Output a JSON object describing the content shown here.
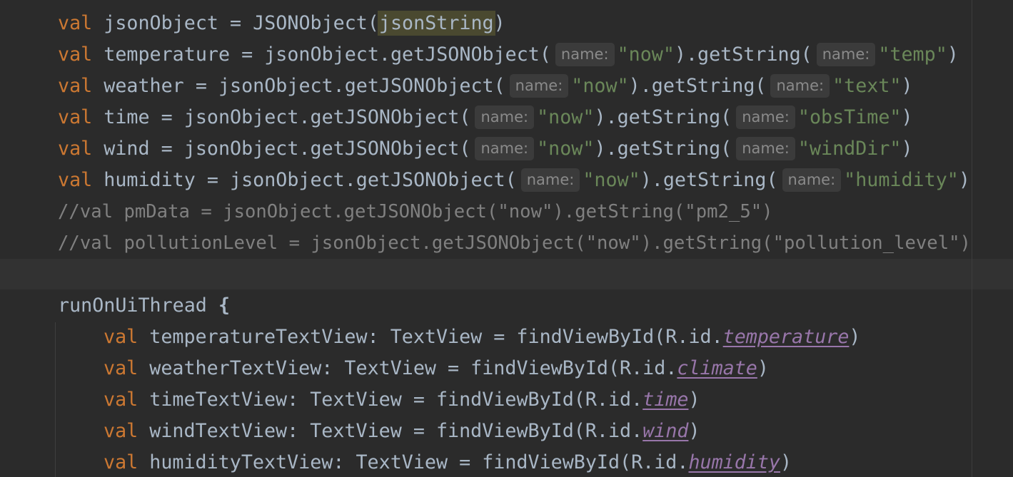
{
  "editor": {
    "lines": [
      {
        "kw": "val",
        "name": "jsonObject",
        "op": " = ",
        "call": "JSONObject(",
        "arg": "jsonString",
        "close": ")"
      },
      {
        "kw": "val",
        "name": "temperature",
        "op": " = ",
        "obj": "jsonObject.getJSONObject(",
        "hint1": "name:",
        "s1": "\"now\"",
        "mid": ").getString(",
        "hint2": "name:",
        "s2": "\"temp\"",
        "close": ")"
      },
      {
        "kw": "val",
        "name": "weather",
        "op": " = ",
        "obj": "jsonObject.getJSONObject(",
        "hint1": "name:",
        "s1": "\"now\"",
        "mid": ").getString(",
        "hint2": "name:",
        "s2": "\"text\"",
        "close": ")"
      },
      {
        "kw": "val",
        "name": "time",
        "op": " = ",
        "obj": "jsonObject.getJSONObject(",
        "hint1": "name:",
        "s1": "\"now\"",
        "mid": ").getString(",
        "hint2": "name:",
        "s2": "\"obsTime\"",
        "close": ")"
      },
      {
        "kw": "val",
        "name": "wind",
        "op": " = ",
        "obj": "jsonObject.getJSONObject(",
        "hint1": "name:",
        "s1": "\"now\"",
        "mid": ").getString(",
        "hint2": "name:",
        "s2": "\"windDir\"",
        "close": ")"
      },
      {
        "kw": "val",
        "name": "humidity",
        "op": " = ",
        "obj": "jsonObject.getJSONObject(",
        "hint1": "name:",
        "s1": "\"now\"",
        "mid": ").getString(",
        "hint2": "name:",
        "s2": "\"humidity\"",
        "close": ")"
      },
      {
        "comment": "//val pmData = jsonObject.getJSONObject(\"now\").getString(\"pm2_5\")"
      },
      {
        "comment": "//val pollutionLevel = jsonObject.getJSONObject(\"now\").getString(\"pollution_level\")"
      },
      {
        "empty": ""
      },
      {
        "call": "runOnUiThread ",
        "brace": "{"
      },
      {
        "kw": "val",
        "name": "temperatureTextView",
        "type": ": TextView = findViewById(R.id.",
        "field": "temperature",
        "close": ")"
      },
      {
        "kw": "val",
        "name": "weatherTextView",
        "type": ": TextView = findViewById(R.id.",
        "field": "climate",
        "close": ")"
      },
      {
        "kw": "val",
        "name": "timeTextView",
        "type": ": TextView = findViewById(R.id.",
        "field": "time",
        "close": ")"
      },
      {
        "kw": "val",
        "name": "windTextView",
        "type": ": TextView = findViewById(R.id.",
        "field": "wind",
        "close": ")"
      },
      {
        "kw": "val",
        "name": "humidityTextView",
        "type": ": TextView = findViewById(R.id.",
        "field": "humidity",
        "close": ")"
      }
    ]
  },
  "colors": {
    "background": "#2b2b2b",
    "keyword": "#cc7832",
    "string": "#6a8759",
    "comment": "#808080",
    "field": "#9876aa",
    "text": "#a9b7c6"
  }
}
